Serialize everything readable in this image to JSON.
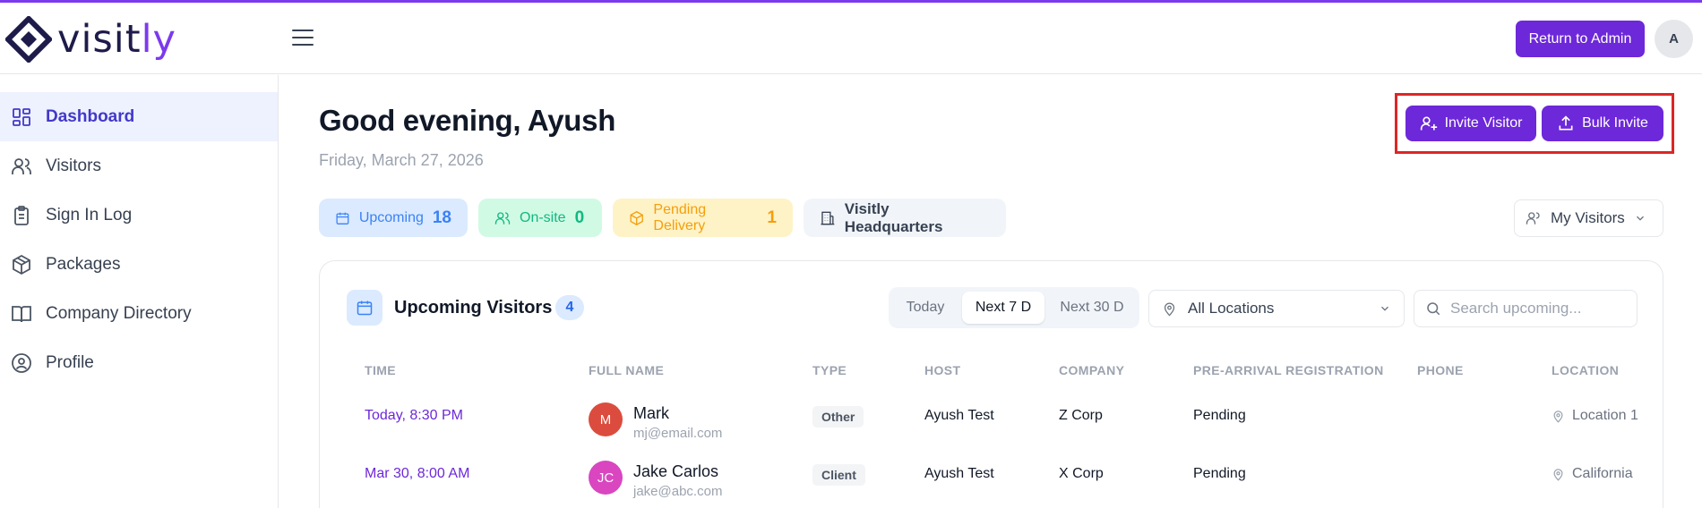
{
  "app": {
    "logo_main": "visit",
    "logo_accent": "ly",
    "return_button": "Return to Admin",
    "avatar_initial": "A"
  },
  "sidebar": {
    "items": [
      {
        "label": "Dashboard",
        "icon": "dashboard-icon",
        "active": true
      },
      {
        "label": "Visitors",
        "icon": "users-icon"
      },
      {
        "label": "Sign In Log",
        "icon": "clipboard-icon"
      },
      {
        "label": "Packages",
        "icon": "package-icon"
      },
      {
        "label": "Company Directory",
        "icon": "book-icon"
      },
      {
        "label": "Profile",
        "icon": "profile-icon"
      }
    ]
  },
  "main": {
    "greeting": "Good evening, Ayush",
    "date": "Friday, March 27, 2026",
    "invite_button": "Invite Visitor",
    "bulk_button": "Bulk Invite",
    "stats": {
      "upcoming_label": "Upcoming",
      "upcoming_count": "18",
      "onsite_label": "On-site",
      "onsite_count": "0",
      "pending_label": "Pending Delivery",
      "pending_count": "1",
      "location_label": "Visitly Headquarters"
    },
    "filter": "My Visitors"
  },
  "card": {
    "title": "Upcoming Visitors",
    "count": "4",
    "ranges": [
      "Today",
      "Next 7 D",
      "Next 30 D"
    ],
    "selected_range": "Next 7 D",
    "location_filter": "All Locations",
    "search_placeholder": "Search upcoming...",
    "columns": [
      "TIME",
      "FULL NAME",
      "TYPE",
      "HOST",
      "COMPANY",
      "PRE-ARRIVAL REGISTRATION",
      "PHONE",
      "LOCATION"
    ],
    "rows": [
      {
        "time": "Today, 8:30 PM",
        "initials": "M",
        "avatar_color": "#dc4c3e",
        "name": "Mark",
        "email": "mj@email.com",
        "type": "Other",
        "host": "Ayush Test",
        "company": "Z Corp",
        "registration": "Pending",
        "phone": "",
        "location": "Location 1"
      },
      {
        "time": "Mar 30, 8:00 AM",
        "initials": "JC",
        "avatar_color": "#d946c0",
        "name": "Jake Carlos",
        "email": "jake@abc.com",
        "type": "Client",
        "host": "Ayush Test",
        "company": "X Corp",
        "registration": "Pending",
        "phone": "",
        "location": "California"
      }
    ]
  },
  "colors": {
    "brand": "#6d28d9",
    "highlight": "#dc2626"
  }
}
